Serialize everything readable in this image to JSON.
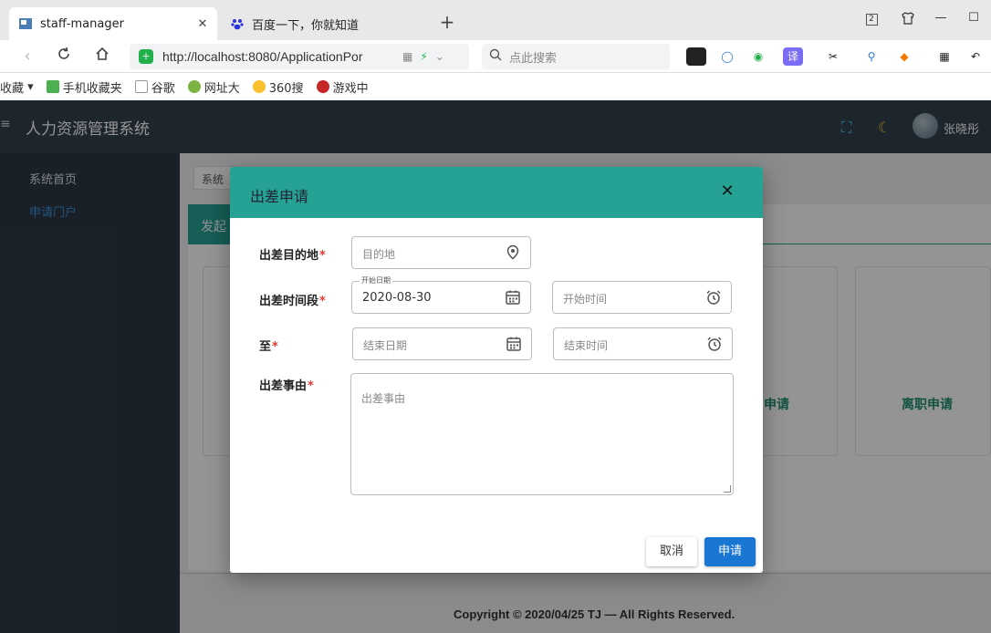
{
  "browser": {
    "tabs": [
      {
        "title": "staff-manager",
        "active": true
      },
      {
        "title": "百度一下，你就知道",
        "active": false
      }
    ],
    "tab_count_badge": "2",
    "url": "http://localhost:8080/ApplicationPor",
    "search_placeholder": "点此搜索",
    "translate_ext": "译",
    "bookmarks": [
      "收藏",
      "手机收藏夹",
      "谷歌",
      "网址大",
      "360搜",
      "游戏中"
    ]
  },
  "app": {
    "title": "人力资源管理系统",
    "user_name": "张晓彤",
    "sidebar": [
      "系统首页",
      "申请门户"
    ],
    "bg_tab": "系统",
    "bg_teal_tab": "发起",
    "bg_labels": [
      "申请",
      "离职申请"
    ],
    "footer": "Copyright © 2020/04/25 TJ — All Rights Reserved."
  },
  "dialog": {
    "title": "出差申请",
    "fields": {
      "destination": {
        "label": "出差目的地",
        "placeholder": "目的地"
      },
      "period": {
        "label": "出差时间段",
        "start_date_floating_label": "开始日期",
        "start_date_value": "2020-08-30",
        "start_time_placeholder": "开始时间"
      },
      "until": {
        "label": "至",
        "end_date_placeholder": "结束日期",
        "end_time_placeholder": "结束时间"
      },
      "reason": {
        "label": "出差事由",
        "placeholder": "出差事由"
      }
    },
    "required_mark": "*",
    "cancel_label": "取消",
    "apply_label": "申请"
  },
  "colors": {
    "header_bg": "#33414e",
    "sidebar_bg": "#2c3845",
    "dialog_header": "#26a294",
    "primary_button": "#1976d2",
    "required": "#e53935"
  }
}
